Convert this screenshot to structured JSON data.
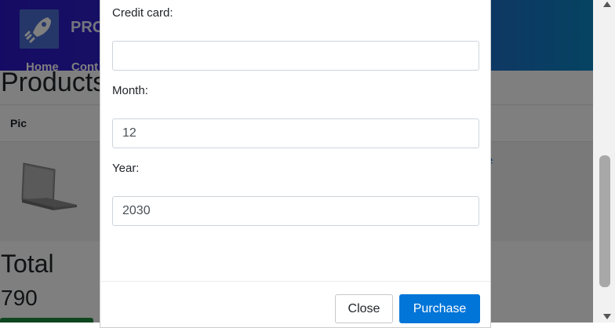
{
  "navbar": {
    "brand": "PRO",
    "links": [
      "Home",
      "Cont"
    ]
  },
  "page": {
    "title": "Products",
    "table": {
      "header_pic": "Pic",
      "delete_link": "e"
    },
    "total_label": "Total",
    "total_value": "790"
  },
  "modal": {
    "credit_card_label": "Credit card:",
    "credit_card_value": "",
    "month_label": "Month:",
    "month_value": "12",
    "year_label": "Year:",
    "year_value": "2030",
    "close_label": "Close",
    "purchase_label": "Purchase"
  },
  "colors": {
    "navbar_start": "#2d17c9",
    "navbar_end": "#0b86c4",
    "primary_button": "#0275d8",
    "order_button": "#1f8a3c"
  },
  "icons": [
    "rocket-logo-icon",
    "scroll-up-icon",
    "scroll-down-icon"
  ]
}
